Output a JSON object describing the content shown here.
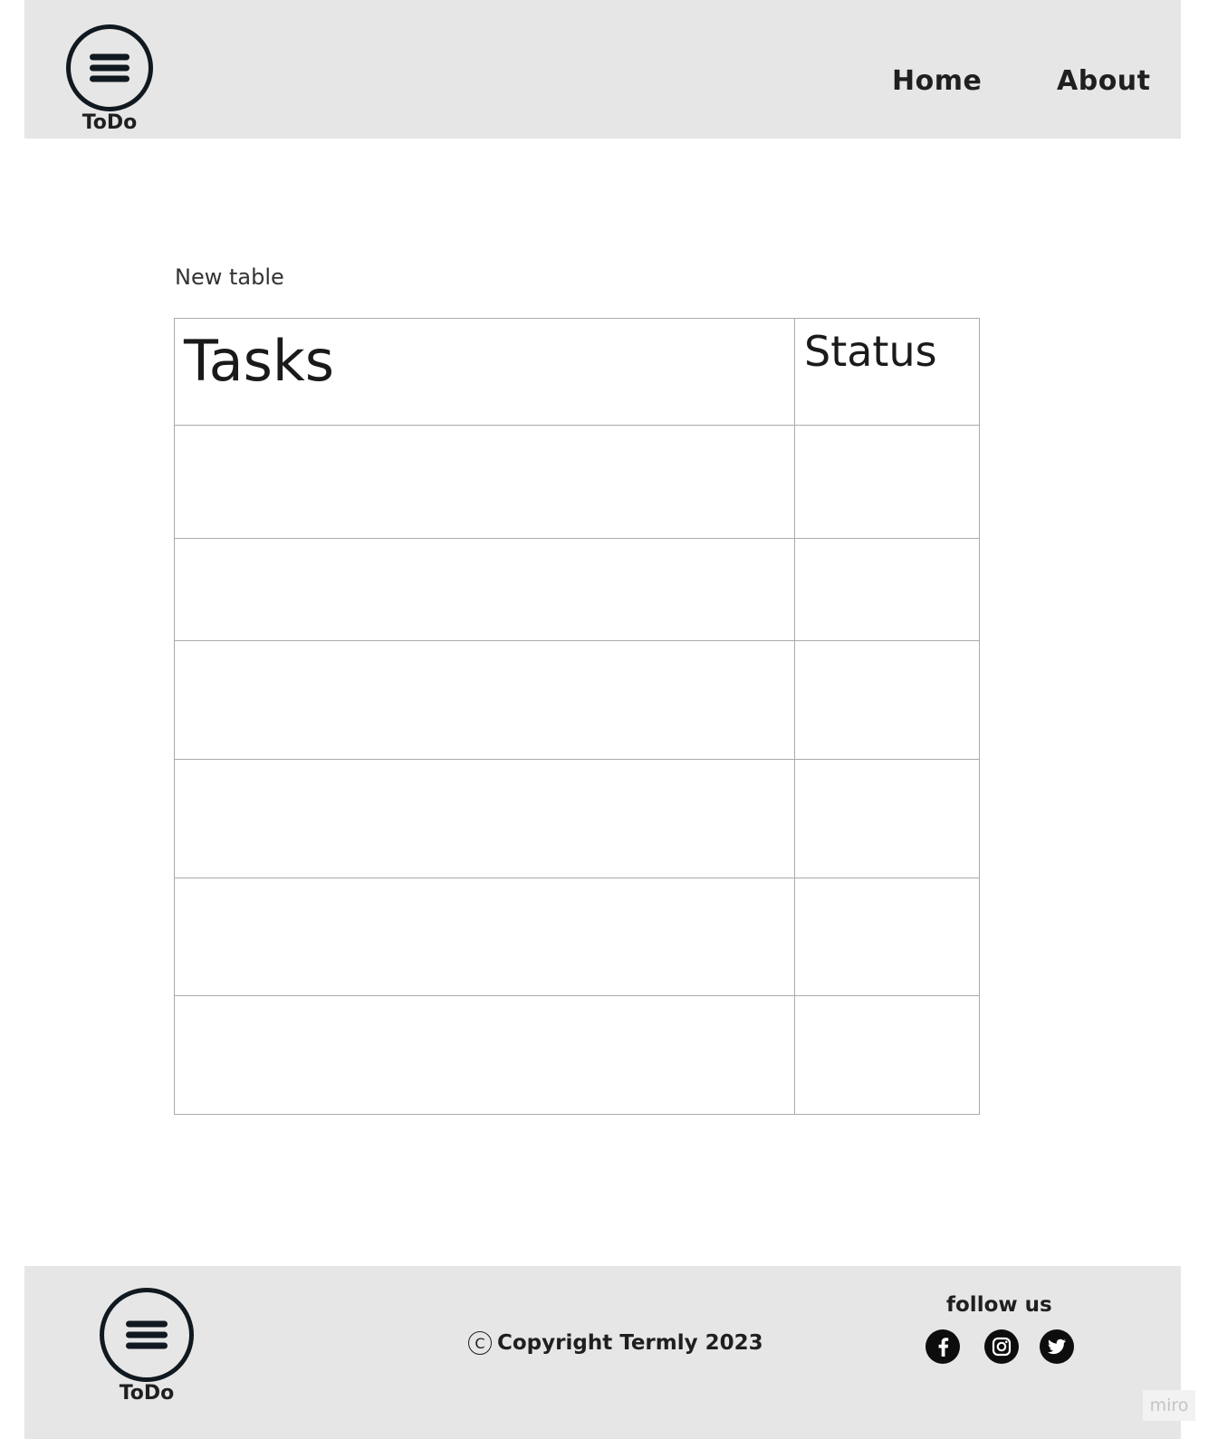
{
  "header": {
    "logo_text": "ToDo",
    "nav": {
      "home": "Home",
      "about": "About"
    }
  },
  "main": {
    "caption": "New table",
    "table": {
      "columns": [
        "Tasks",
        "Status"
      ],
      "rows": [
        [
          "",
          ""
        ],
        [
          "",
          ""
        ],
        [
          "",
          ""
        ],
        [
          "",
          ""
        ],
        [
          "",
          ""
        ],
        [
          "",
          ""
        ]
      ]
    }
  },
  "footer": {
    "logo_text": "ToDo",
    "copyright_symbol": "C",
    "copyright": "Copyright Termly 2023",
    "follow_label": "follow us",
    "social_icons": [
      "facebook-icon",
      "instagram-icon",
      "twitter-icon"
    ]
  },
  "watermark": "miro",
  "colors": {
    "header_bg": "#e6e6e6",
    "footer_bg": "#e6e6e6",
    "logo": "#101820",
    "grid_border": "#aaaaaa"
  }
}
